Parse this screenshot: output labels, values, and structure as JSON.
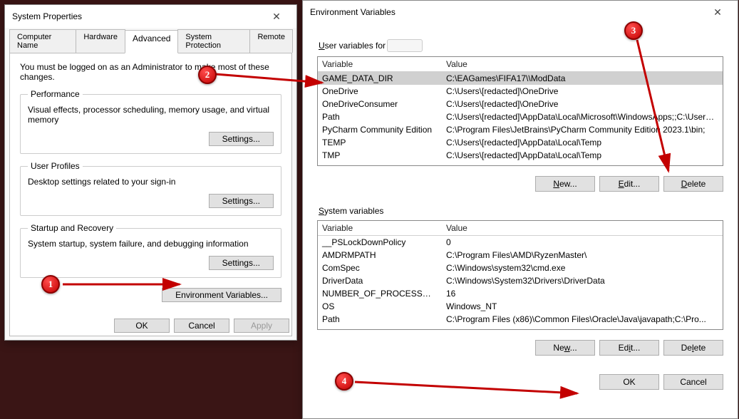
{
  "sysprops": {
    "title": "System Properties",
    "tabs": [
      "Computer Name",
      "Hardware",
      "Advanced",
      "System Protection",
      "Remote"
    ],
    "active_tab": "Advanced",
    "note": "You must be logged on as an Administrator to make most of these changes.",
    "perf": {
      "legend": "Performance",
      "text": "Visual effects, processor scheduling, memory usage, and virtual memory",
      "button": "Settings..."
    },
    "profiles": {
      "legend": "User Profiles",
      "text": "Desktop settings related to your sign-in",
      "button": "Settings..."
    },
    "startup": {
      "legend": "Startup and Recovery",
      "text": "System startup, system failure, and debugging information",
      "button": "Settings..."
    },
    "env_button": "Environment Variables...",
    "ok": "OK",
    "cancel": "Cancel",
    "apply": "Apply"
  },
  "env": {
    "title": "Environment Variables",
    "user_label_prefix": "User variables for",
    "col_variable": "Variable",
    "col_value": "Value",
    "user_vars": [
      {
        "name": "GAME_DATA_DIR",
        "value": "C:\\EAGames\\FIFA17\\\\ModData",
        "selected": true
      },
      {
        "name": "OneDrive",
        "value": "C:\\Users\\[redacted]\\OneDrive"
      },
      {
        "name": "OneDriveConsumer",
        "value": "C:\\Users\\[redacted]\\OneDrive"
      },
      {
        "name": "Path",
        "value": "C:\\Users\\[redacted]\\AppData\\Local\\Microsoft\\WindowsApps;;C:\\Users\\..."
      },
      {
        "name": "PyCharm Community Edition",
        "value": "C:\\Program Files\\JetBrains\\PyCharm Community Edition 2023.1\\bin;"
      },
      {
        "name": "TEMP",
        "value": "C:\\Users\\[redacted]\\AppData\\Local\\Temp"
      },
      {
        "name": "TMP",
        "value": "C:\\Users\\[redacted]\\AppData\\Local\\Temp"
      }
    ],
    "user_buttons": {
      "new": "New...",
      "edit": "Edit...",
      "delete": "Delete"
    },
    "sys_label": "System variables",
    "sys_vars": [
      {
        "name": "__PSLockDownPolicy",
        "value": "0"
      },
      {
        "name": "AMDRMPATH",
        "value": "C:\\Program Files\\AMD\\RyzenMaster\\"
      },
      {
        "name": "ComSpec",
        "value": "C:\\Windows\\system32\\cmd.exe"
      },
      {
        "name": "DriverData",
        "value": "C:\\Windows\\System32\\Drivers\\DriverData"
      },
      {
        "name": "NUMBER_OF_PROCESSORS",
        "value": "16"
      },
      {
        "name": "OS",
        "value": "Windows_NT"
      },
      {
        "name": "Path",
        "value": "C:\\Program Files (x86)\\Common Files\\Oracle\\Java\\javapath;C:\\Pro..."
      }
    ],
    "sys_buttons": {
      "new": "New...",
      "edit": "Edit...",
      "delete": "Delete"
    },
    "ok": "OK",
    "cancel": "Cancel"
  },
  "annotations": {
    "badges": [
      "1",
      "2",
      "3",
      "4"
    ]
  }
}
